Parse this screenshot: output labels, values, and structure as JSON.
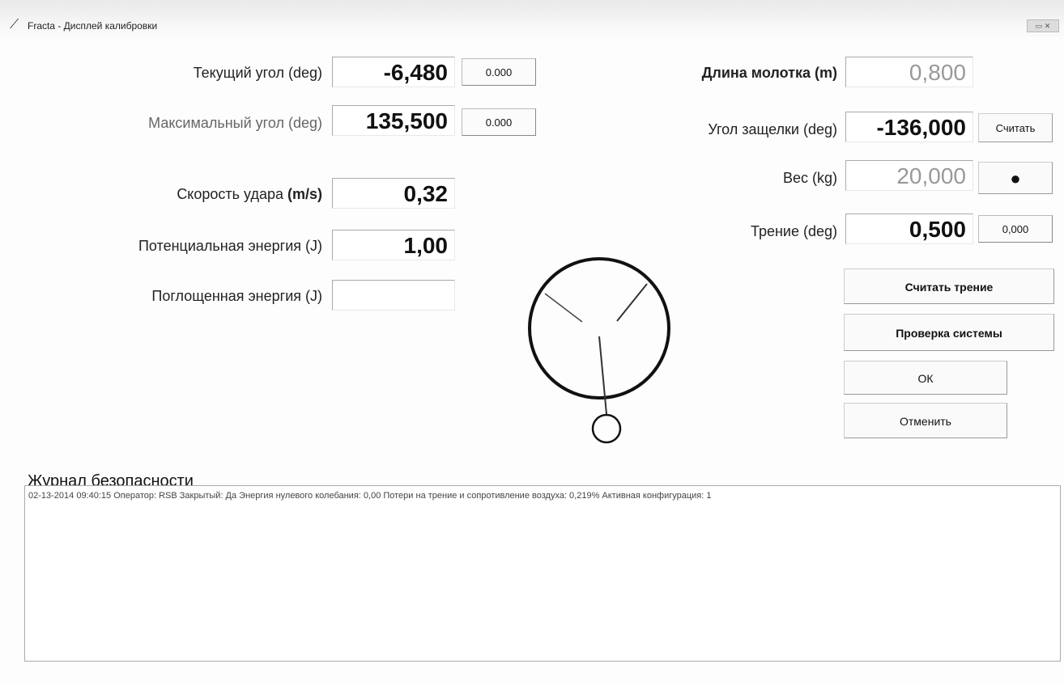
{
  "window": {
    "title": "Fracta - Дисплей калибровки",
    "controls": "▭ ✕"
  },
  "fields_left": [
    {
      "label": "Текущий угол (deg)",
      "value": "-6,480",
      "aux": "0.000"
    },
    {
      "label": "Максимальный угол (deg)",
      "value": "135,500",
      "aux": "0.000"
    },
    {
      "label_main": "Скорость удара ",
      "label_unit": "(m/s)",
      "value": "0,32"
    },
    {
      "label": "Потенциальная энергия (J)",
      "value": "1,00"
    },
    {
      "label": "Поглощенная энергия (J)",
      "value": ""
    }
  ],
  "fields_right": [
    {
      "label": "Длина молотка (m)",
      "value": "0,800"
    },
    {
      "label": "Угол защелки (deg)",
      "value": "-136,000",
      "button": "Считать"
    },
    {
      "label": "Вес (kg)",
      "value": "20,000",
      "button_icon": "weight-icon"
    },
    {
      "label": "Трение (deg)",
      "value": "0,500",
      "aux": "0,000"
    }
  ],
  "buttons": {
    "read_friction": "Считать трение",
    "system_check": "Проверка системы",
    "ok": "ОК",
    "cancel": "Отменить"
  },
  "journal": {
    "title": "Журнал безопасности",
    "entry": "02-13-2014 09:40:15 Оператор: RSB Закрытый: Да  Энергия нулевого колебания: 0,00 Потери на трение и сопротивление воздуха: 0,219%  Активная конфигурация: 1"
  },
  "pendulum": {
    "current_angle_deg": -6.48
  }
}
